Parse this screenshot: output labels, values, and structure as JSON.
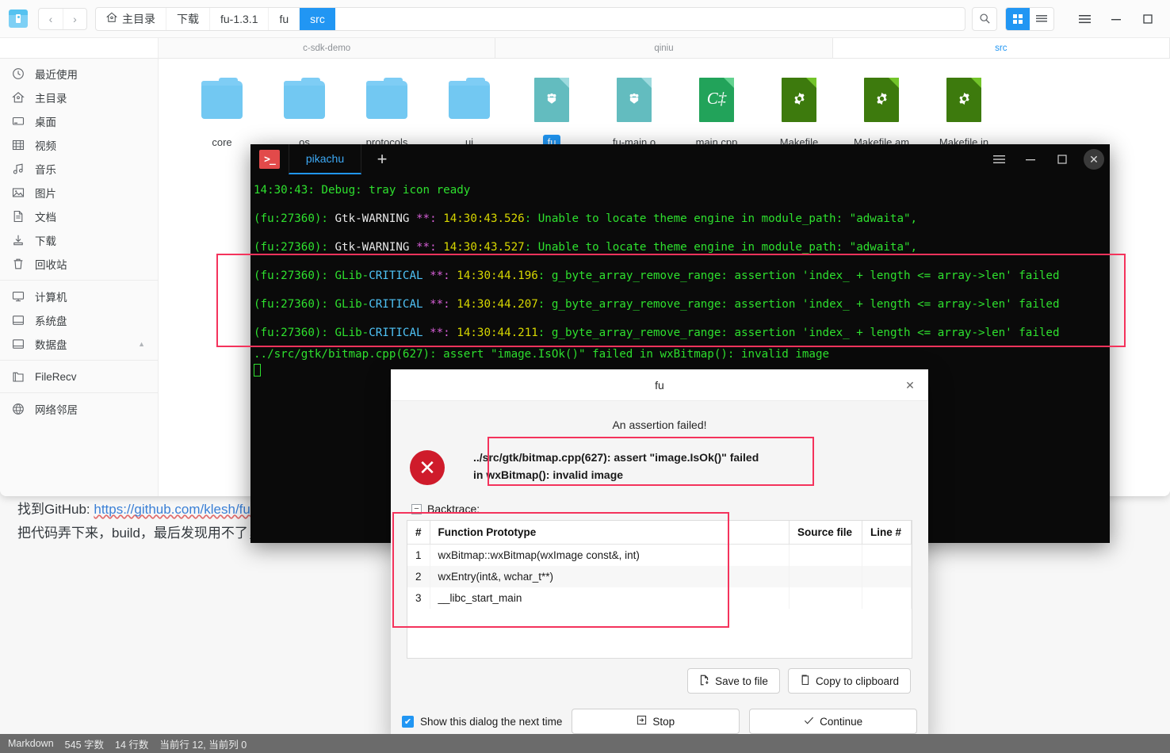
{
  "background_editor": {
    "line1_prefix": "找到GitHub: ",
    "line1_link": "https://github.com/klesh/fu",
    "line2": "把代码弄下来，build，最后发现用不了，一运行就报错，后面运",
    "status_bar": {
      "format": "Markdown",
      "word_count": "545 字数",
      "line_count": "14 行数",
      "cursor": "当前行 12, 当前列 0"
    }
  },
  "file_manager": {
    "app_icon": "file-manager-icon",
    "nav": {
      "back": "‹",
      "forward": "›"
    },
    "breadcrumb": [
      {
        "label": "主目录",
        "icon": "home-icon",
        "active": false
      },
      {
        "label": "下载",
        "active": false
      },
      {
        "label": "fu-1.3.1",
        "active": false
      },
      {
        "label": "fu",
        "active": false
      },
      {
        "label": "src",
        "active": true
      }
    ],
    "toolbar": {
      "search": "search-icon",
      "grid_view": "grid-view-icon",
      "list_view": "list-view-icon",
      "menu": "hamburger-menu-icon",
      "minimize": "minimize-icon",
      "maximize": "maximize-icon"
    },
    "tabs": [
      {
        "label": "c-sdk-demo",
        "active": false
      },
      {
        "label": "qiniu",
        "active": false
      },
      {
        "label": "src",
        "active": true
      }
    ],
    "sidebar": [
      {
        "label": "最近使用",
        "icon": "clock-icon"
      },
      {
        "label": "主目录",
        "icon": "home-icon"
      },
      {
        "label": "桌面",
        "icon": "desktop-icon"
      },
      {
        "label": "视频",
        "icon": "video-icon"
      },
      {
        "label": "音乐",
        "icon": "music-icon"
      },
      {
        "label": "图片",
        "icon": "picture-icon"
      },
      {
        "label": "文档",
        "icon": "document-icon"
      },
      {
        "label": "下载",
        "icon": "download-icon"
      },
      {
        "label": "回收站",
        "icon": "trash-icon"
      },
      {
        "label": "计算机",
        "icon": "computer-icon",
        "group": 2
      },
      {
        "label": "系统盘",
        "icon": "disk-icon",
        "group": 2
      },
      {
        "label": "数据盘",
        "icon": "disk-icon",
        "group": 2,
        "eject": true
      },
      {
        "label": "FileRecv",
        "icon": "folder-recv-icon",
        "group": 3
      },
      {
        "label": "网络邻居",
        "icon": "network-icon",
        "group": 4
      }
    ],
    "files": [
      {
        "name": "core",
        "type": "folder",
        "selected": false
      },
      {
        "name": "os",
        "type": "folder",
        "selected": false
      },
      {
        "name": "protocols",
        "type": "folder",
        "selected": false
      },
      {
        "name": "ui",
        "type": "folder",
        "selected": false
      },
      {
        "name": "fu",
        "type": "binary",
        "selected": true
      },
      {
        "name": "fu-main.o",
        "type": "binary",
        "selected": false
      },
      {
        "name": "main.cpp",
        "type": "cpp",
        "selected": false,
        "glyph": "C‡"
      },
      {
        "name": "Makefile",
        "type": "makefile",
        "selected": false
      },
      {
        "name": "Makefile.am",
        "type": "makefile",
        "selected": false
      },
      {
        "name": "Makefile.in",
        "type": "makefile",
        "selected": false
      }
    ]
  },
  "terminal": {
    "logo": ">_",
    "tab": "pikachu",
    "new_tab": "+",
    "controls": {
      "menu": "hamburger-menu-icon",
      "minimize": "minimize-icon",
      "maximize": "maximize-icon",
      "close": "close-icon"
    },
    "lines": [
      {
        "segments": [
          {
            "t": "14:30:43: Debug: tray icon ready",
            "c": "green"
          }
        ]
      },
      {
        "segments": [
          {
            "t": "(fu:27360): ",
            "c": "green"
          },
          {
            "t": "Gtk-WARNING",
            "c": "white"
          },
          {
            "t": " **: ",
            "c": "magenta"
          },
          {
            "t": "14:30:43.526",
            "c": "yellow"
          },
          {
            "t": ": Unable to locate theme engine in module_path: \"adwaita\",",
            "c": "green"
          }
        ]
      },
      {
        "segments": [
          {
            "t": "(fu:27360): ",
            "c": "green"
          },
          {
            "t": "Gtk-WARNING",
            "c": "white"
          },
          {
            "t": " **: ",
            "c": "magenta"
          },
          {
            "t": "14:30:43.527",
            "c": "yellow"
          },
          {
            "t": ": Unable to locate theme engine in module_path: \"adwaita\",",
            "c": "green"
          }
        ]
      },
      {
        "segments": [
          {
            "t": "(fu:27360): ",
            "c": "green"
          },
          {
            "t": "GLib-",
            "c": "green"
          },
          {
            "t": "CRITICAL",
            "c": "cyan"
          },
          {
            "t": " **: ",
            "c": "magenta"
          },
          {
            "t": "14:30:44.196",
            "c": "yellow"
          },
          {
            "t": ": g_byte_array_remove_range: assertion 'index_ + length <= array->len' failed",
            "c": "green"
          }
        ]
      },
      {
        "segments": [
          {
            "t": "(fu:27360): ",
            "c": "green"
          },
          {
            "t": "GLib-",
            "c": "green"
          },
          {
            "t": "CRITICAL",
            "c": "cyan"
          },
          {
            "t": " **: ",
            "c": "magenta"
          },
          {
            "t": "14:30:44.207",
            "c": "yellow"
          },
          {
            "t": ": g_byte_array_remove_range: assertion 'index_ + length <= array->len' failed",
            "c": "green"
          }
        ]
      },
      {
        "segments": [
          {
            "t": "(fu:27360): ",
            "c": "green"
          },
          {
            "t": "GLib-",
            "c": "green"
          },
          {
            "t": "CRITICAL",
            "c": "cyan"
          },
          {
            "t": " **: ",
            "c": "magenta"
          },
          {
            "t": "14:30:44.211",
            "c": "yellow"
          },
          {
            "t": ": g_byte_array_remove_range: assertion 'index_ + length <= array->len' failed",
            "c": "green"
          }
        ]
      },
      {
        "tight": true,
        "segments": [
          {
            "t": "../src/gtk/bitmap.cpp(627): assert \"image.IsOk()\" failed in wxBitmap(): invalid image",
            "c": "green"
          }
        ]
      }
    ]
  },
  "dialog": {
    "title": "fu",
    "close": "close-icon",
    "headline": "An assertion failed!",
    "error_icon": "error-x-icon",
    "error_message": "../src/gtk/bitmap.cpp(627): assert \"image.IsOk()\" failed in wxBitmap(): invalid image",
    "backtrace_label": "Backtrace:",
    "backtrace_toggle": "−",
    "backtrace_columns": [
      "#",
      "Function Prototype",
      "Source file",
      "Line #"
    ],
    "backtrace_rows": [
      {
        "num": "1",
        "fn": "wxBitmap::wxBitmap(wxImage const&, int)",
        "src": "",
        "line": ""
      },
      {
        "num": "2",
        "fn": "wxEntry(int&, wchar_t**)",
        "src": "",
        "line": ""
      },
      {
        "num": "3",
        "fn": "__libc_start_main",
        "src": "",
        "line": ""
      }
    ],
    "save_button": "Save to file",
    "save_icon": "save-file-icon",
    "copy_button": "Copy to clipboard",
    "copy_icon": "clipboard-icon",
    "checkbox_label": "Show this dialog the next time",
    "checkbox_checked": true,
    "stop_button": "Stop",
    "stop_icon": "stop-icon",
    "continue_button": "Continue",
    "continue_icon": "check-icon"
  },
  "colors": {
    "accent_blue": "#2196f3",
    "annotation_red": "#f4335c",
    "terminal_bg": "#0a0a0a",
    "terminal_green": "#2ee02e",
    "error_red": "#cf1b2b",
    "folder_blue": "#72c8f2",
    "binary_teal": "#63bcbf",
    "cpp_green": "#22a35a",
    "makefile_green": "#3d7a0d"
  }
}
